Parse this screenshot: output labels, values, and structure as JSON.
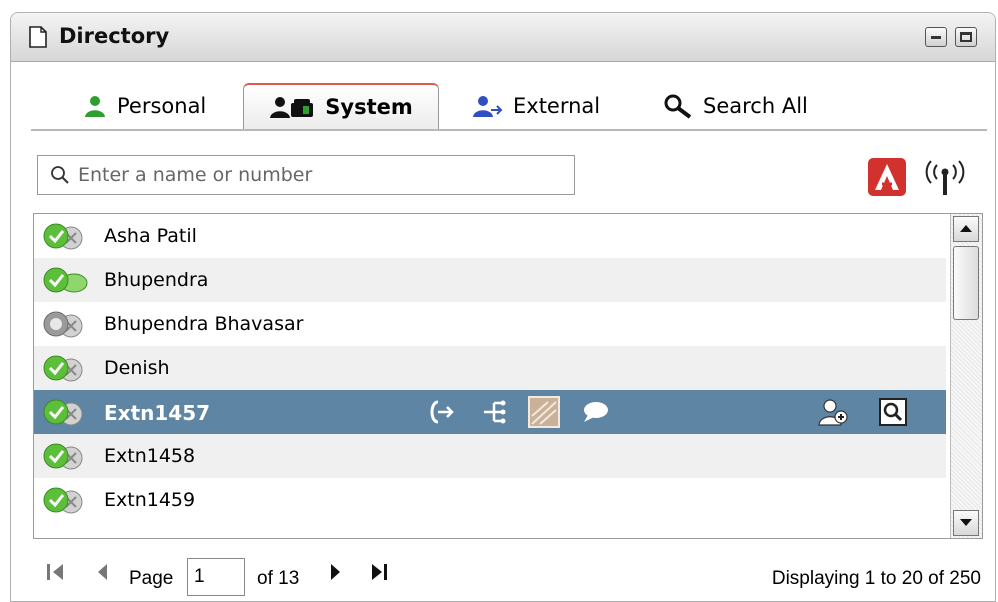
{
  "window": {
    "title": "Directory"
  },
  "tabs": [
    {
      "label": "Personal",
      "icon": "personal-person-icon",
      "color": "#2e9e2e"
    },
    {
      "label": "System",
      "icon": "system-person-phone-icon",
      "color": "#111111"
    },
    {
      "label": "External",
      "icon": "external-person-icon",
      "color": "#2f4fc4"
    },
    {
      "label": "Search All",
      "icon": "magnifier-icon"
    }
  ],
  "active_tab": "System",
  "search": {
    "placeholder": "Enter a name or number",
    "value": ""
  },
  "contacts": [
    {
      "name": "Asha Patil",
      "status": "available-offline-chat"
    },
    {
      "name": "Bhupendra",
      "status": "available-chat"
    },
    {
      "name": "Bhupendra Bhavasar",
      "status": "offline"
    },
    {
      "name": "Denish",
      "status": "available-offline-chat"
    },
    {
      "name": "Extn1457",
      "status": "available-offline-chat",
      "selected": true
    },
    {
      "name": "Extn1458",
      "status": "available-offline-chat"
    },
    {
      "name": "Extn1459",
      "status": "available-offline-chat"
    }
  ],
  "row_actions": [
    "transfer-icon",
    "conference-icon",
    "video-icon",
    "chat-bubble-icon",
    "add-contact-icon",
    "details-icon"
  ],
  "pager": {
    "page_label": "Page",
    "page_value": "1",
    "of_text": "of 13",
    "display_text": "Displaying 1 to 20 of 250"
  },
  "colors": {
    "selected_row": "#5f85a4",
    "alt_row": "#f0f0f0",
    "active_tab_accent": "#e05a4f",
    "logo_red": "#d2322d"
  }
}
